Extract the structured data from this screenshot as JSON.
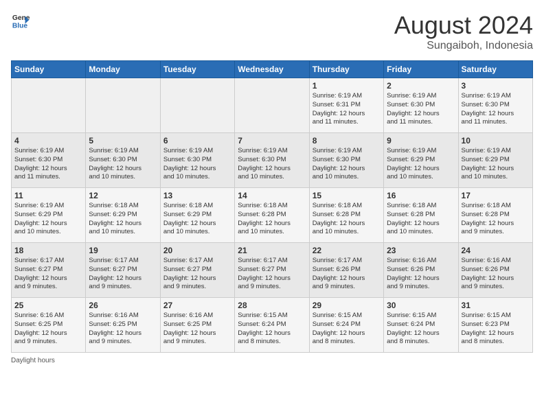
{
  "header": {
    "logo_line1": "General",
    "logo_line2": "Blue",
    "title": "August 2024",
    "subtitle": "Sungaiboh, Indonesia"
  },
  "days_of_week": [
    "Sunday",
    "Monday",
    "Tuesday",
    "Wednesday",
    "Thursday",
    "Friday",
    "Saturday"
  ],
  "weeks": [
    [
      {
        "day": "",
        "info": ""
      },
      {
        "day": "",
        "info": ""
      },
      {
        "day": "",
        "info": ""
      },
      {
        "day": "",
        "info": ""
      },
      {
        "day": "1",
        "info": "Sunrise: 6:19 AM\nSunset: 6:31 PM\nDaylight: 12 hours\nand 11 minutes."
      },
      {
        "day": "2",
        "info": "Sunrise: 6:19 AM\nSunset: 6:30 PM\nDaylight: 12 hours\nand 11 minutes."
      },
      {
        "day": "3",
        "info": "Sunrise: 6:19 AM\nSunset: 6:30 PM\nDaylight: 12 hours\nand 11 minutes."
      }
    ],
    [
      {
        "day": "4",
        "info": "Sunrise: 6:19 AM\nSunset: 6:30 PM\nDaylight: 12 hours\nand 11 minutes."
      },
      {
        "day": "5",
        "info": "Sunrise: 6:19 AM\nSunset: 6:30 PM\nDaylight: 12 hours\nand 10 minutes."
      },
      {
        "day": "6",
        "info": "Sunrise: 6:19 AM\nSunset: 6:30 PM\nDaylight: 12 hours\nand 10 minutes."
      },
      {
        "day": "7",
        "info": "Sunrise: 6:19 AM\nSunset: 6:30 PM\nDaylight: 12 hours\nand 10 minutes."
      },
      {
        "day": "8",
        "info": "Sunrise: 6:19 AM\nSunset: 6:30 PM\nDaylight: 12 hours\nand 10 minutes."
      },
      {
        "day": "9",
        "info": "Sunrise: 6:19 AM\nSunset: 6:29 PM\nDaylight: 12 hours\nand 10 minutes."
      },
      {
        "day": "10",
        "info": "Sunrise: 6:19 AM\nSunset: 6:29 PM\nDaylight: 12 hours\nand 10 minutes."
      }
    ],
    [
      {
        "day": "11",
        "info": "Sunrise: 6:19 AM\nSunset: 6:29 PM\nDaylight: 12 hours\nand 10 minutes."
      },
      {
        "day": "12",
        "info": "Sunrise: 6:18 AM\nSunset: 6:29 PM\nDaylight: 12 hours\nand 10 minutes."
      },
      {
        "day": "13",
        "info": "Sunrise: 6:18 AM\nSunset: 6:29 PM\nDaylight: 12 hours\nand 10 minutes."
      },
      {
        "day": "14",
        "info": "Sunrise: 6:18 AM\nSunset: 6:28 PM\nDaylight: 12 hours\nand 10 minutes."
      },
      {
        "day": "15",
        "info": "Sunrise: 6:18 AM\nSunset: 6:28 PM\nDaylight: 12 hours\nand 10 minutes."
      },
      {
        "day": "16",
        "info": "Sunrise: 6:18 AM\nSunset: 6:28 PM\nDaylight: 12 hours\nand 10 minutes."
      },
      {
        "day": "17",
        "info": "Sunrise: 6:18 AM\nSunset: 6:28 PM\nDaylight: 12 hours\nand 9 minutes."
      }
    ],
    [
      {
        "day": "18",
        "info": "Sunrise: 6:17 AM\nSunset: 6:27 PM\nDaylight: 12 hours\nand 9 minutes."
      },
      {
        "day": "19",
        "info": "Sunrise: 6:17 AM\nSunset: 6:27 PM\nDaylight: 12 hours\nand 9 minutes."
      },
      {
        "day": "20",
        "info": "Sunrise: 6:17 AM\nSunset: 6:27 PM\nDaylight: 12 hours\nand 9 minutes."
      },
      {
        "day": "21",
        "info": "Sunrise: 6:17 AM\nSunset: 6:27 PM\nDaylight: 12 hours\nand 9 minutes."
      },
      {
        "day": "22",
        "info": "Sunrise: 6:17 AM\nSunset: 6:26 PM\nDaylight: 12 hours\nand 9 minutes."
      },
      {
        "day": "23",
        "info": "Sunrise: 6:16 AM\nSunset: 6:26 PM\nDaylight: 12 hours\nand 9 minutes."
      },
      {
        "day": "24",
        "info": "Sunrise: 6:16 AM\nSunset: 6:26 PM\nDaylight: 12 hours\nand 9 minutes."
      }
    ],
    [
      {
        "day": "25",
        "info": "Sunrise: 6:16 AM\nSunset: 6:25 PM\nDaylight: 12 hours\nand 9 minutes."
      },
      {
        "day": "26",
        "info": "Sunrise: 6:16 AM\nSunset: 6:25 PM\nDaylight: 12 hours\nand 9 minutes."
      },
      {
        "day": "27",
        "info": "Sunrise: 6:16 AM\nSunset: 6:25 PM\nDaylight: 12 hours\nand 9 minutes."
      },
      {
        "day": "28",
        "info": "Sunrise: 6:15 AM\nSunset: 6:24 PM\nDaylight: 12 hours\nand 8 minutes."
      },
      {
        "day": "29",
        "info": "Sunrise: 6:15 AM\nSunset: 6:24 PM\nDaylight: 12 hours\nand 8 minutes."
      },
      {
        "day": "30",
        "info": "Sunrise: 6:15 AM\nSunset: 6:24 PM\nDaylight: 12 hours\nand 8 minutes."
      },
      {
        "day": "31",
        "info": "Sunrise: 6:15 AM\nSunset: 6:23 PM\nDaylight: 12 hours\nand 8 minutes."
      }
    ]
  ],
  "footer": {
    "label": "Daylight hours"
  }
}
